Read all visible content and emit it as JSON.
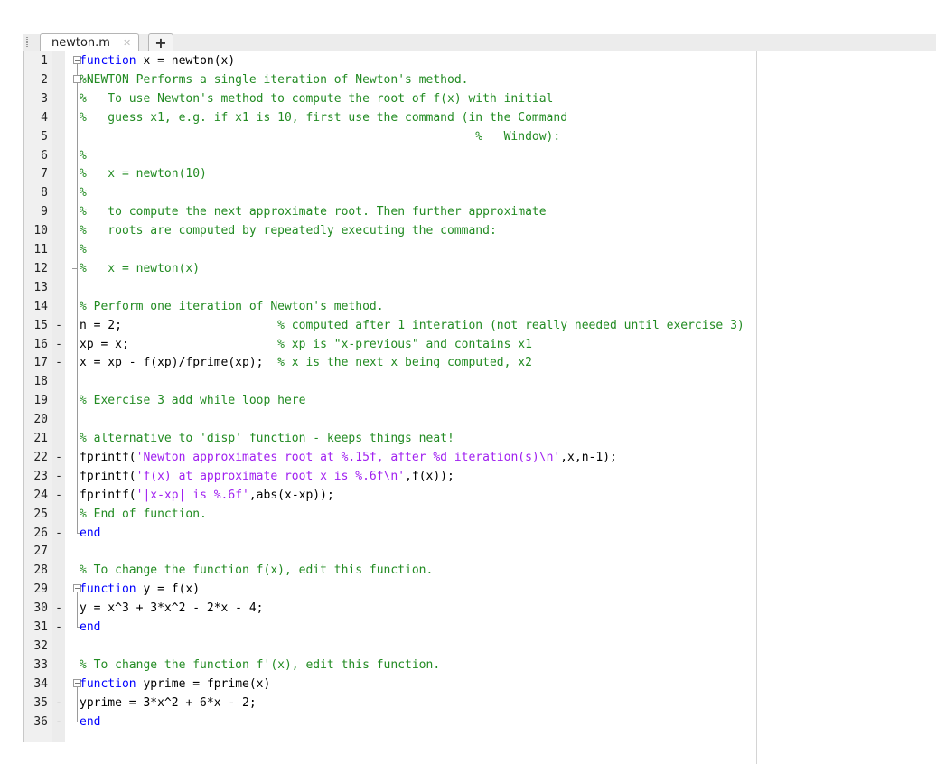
{
  "tabbar": {
    "active_tab": "newton.m",
    "close_glyph": "✕",
    "add_glyph": "+"
  },
  "colors": {
    "keyword": "#0000ff",
    "comment": "#228b22",
    "string": "#a020f0",
    "default": "#000000"
  },
  "lines": [
    {
      "n": "1",
      "mark": "",
      "fold": "start",
      "tokens": [
        [
          "kw",
          "function"
        ],
        [
          "",
          " x = newton(x)"
        ]
      ]
    },
    {
      "n": "2",
      "mark": "",
      "fold": "start2",
      "tokens": [
        [
          "cm",
          "%NEWTON Performs a single iteration of Newton's method."
        ]
      ]
    },
    {
      "n": "3",
      "mark": "",
      "fold": "mid",
      "tokens": [
        [
          "cm",
          "%   To use Newton's method to compute the root of f(x) with initial"
        ]
      ]
    },
    {
      "n": "4",
      "mark": "",
      "fold": "mid",
      "tokens": [
        [
          "cm",
          "%   guess x1, e.g. if x1 is 10, first use the command (in the Command"
        ]
      ]
    },
    {
      "n": "5",
      "mark": "",
      "fold": "mid",
      "tokens": [
        [
          "cm",
          "                                                        %   Window):"
        ]
      ]
    },
    {
      "n": "6",
      "mark": "",
      "fold": "mid",
      "tokens": [
        [
          "cm",
          "%"
        ]
      ]
    },
    {
      "n": "7",
      "mark": "",
      "fold": "mid",
      "tokens": [
        [
          "cm",
          "%   x = newton(10)"
        ]
      ]
    },
    {
      "n": "8",
      "mark": "",
      "fold": "mid",
      "tokens": [
        [
          "cm",
          "%"
        ]
      ]
    },
    {
      "n": "9",
      "mark": "",
      "fold": "mid",
      "tokens": [
        [
          "cm",
          "%   to compute the next approximate root. Then further approximate"
        ]
      ]
    },
    {
      "n": "10",
      "mark": "",
      "fold": "mid",
      "tokens": [
        [
          "cm",
          "%   roots are computed by repeatedly executing the command:"
        ]
      ]
    },
    {
      "n": "11",
      "mark": "",
      "fold": "mid",
      "tokens": [
        [
          "cm",
          "%"
        ]
      ]
    },
    {
      "n": "12",
      "mark": "",
      "fold": "tick",
      "tokens": [
        [
          "cm",
          "%   x = newton(x)"
        ]
      ]
    },
    {
      "n": "13",
      "mark": "",
      "fold": "mid",
      "tokens": []
    },
    {
      "n": "14",
      "mark": "",
      "fold": "mid",
      "tokens": [
        [
          "cm",
          "% Perform one iteration of Newton's method."
        ]
      ]
    },
    {
      "n": "15",
      "mark": "-",
      "fold": "mid",
      "tokens": [
        [
          "",
          "n = 2;                      "
        ],
        [
          "cm",
          "% computed after 1 interation (not really needed until exercise 3)"
        ]
      ]
    },
    {
      "n": "16",
      "mark": "-",
      "fold": "mid",
      "tokens": [
        [
          "",
          "xp = x;                     "
        ],
        [
          "cm",
          "% xp is \"x-previous\" and contains x1"
        ]
      ]
    },
    {
      "n": "17",
      "mark": "-",
      "fold": "mid",
      "tokens": [
        [
          "",
          "x = xp - f(xp)/fprime(xp);  "
        ],
        [
          "cm",
          "% x is the next x being computed, x2"
        ]
      ]
    },
    {
      "n": "18",
      "mark": "",
      "fold": "mid",
      "tokens": []
    },
    {
      "n": "19",
      "mark": "",
      "fold": "mid",
      "tokens": [
        [
          "cm",
          "% Exercise 3 add while loop here"
        ]
      ]
    },
    {
      "n": "20",
      "mark": "",
      "fold": "mid",
      "tokens": []
    },
    {
      "n": "21",
      "mark": "",
      "fold": "mid",
      "tokens": [
        [
          "cm",
          "% alternative to 'disp' function - keeps things neat!"
        ]
      ]
    },
    {
      "n": "22",
      "mark": "-",
      "fold": "mid",
      "tokens": [
        [
          "",
          "fprintf("
        ],
        [
          "st",
          "'Newton approximates root at %.15f, after %d iteration(s)\\n'"
        ],
        [
          "",
          ",x,n-1);"
        ]
      ]
    },
    {
      "n": "23",
      "mark": "-",
      "fold": "mid",
      "tokens": [
        [
          "",
          "fprintf("
        ],
        [
          "st",
          "'f(x) at approximate root x is %.6f\\n'"
        ],
        [
          "",
          ",f(x));"
        ]
      ]
    },
    {
      "n": "24",
      "mark": "-",
      "fold": "mid",
      "tokens": [
        [
          "",
          "fprintf("
        ],
        [
          "st",
          "'|x-xp| is %.6f'"
        ],
        [
          "",
          ",abs(x-xp));"
        ]
      ]
    },
    {
      "n": "25",
      "mark": "",
      "fold": "mid",
      "tokens": [
        [
          "cm",
          "% End of function."
        ]
      ]
    },
    {
      "n": "26",
      "mark": "-",
      "fold": "end",
      "tokens": [
        [
          "kw",
          "end"
        ]
      ]
    },
    {
      "n": "27",
      "mark": "",
      "fold": "",
      "tokens": []
    },
    {
      "n": "28",
      "mark": "",
      "fold": "",
      "tokens": [
        [
          "cm",
          "% To change the function f(x), edit this function."
        ]
      ]
    },
    {
      "n": "29",
      "mark": "",
      "fold": "start",
      "tokens": [
        [
          "kw",
          "function"
        ],
        [
          "",
          " y = f(x)"
        ]
      ]
    },
    {
      "n": "30",
      "mark": "-",
      "fold": "mid",
      "tokens": [
        [
          "",
          "y = x^3 + 3*x^2 - 2*x - 4;"
        ]
      ]
    },
    {
      "n": "31",
      "mark": "-",
      "fold": "end",
      "tokens": [
        [
          "kw",
          "end"
        ]
      ]
    },
    {
      "n": "32",
      "mark": "",
      "fold": "",
      "tokens": []
    },
    {
      "n": "33",
      "mark": "",
      "fold": "",
      "tokens": [
        [
          "cm",
          "% To change the function f'(x), edit this function."
        ]
      ]
    },
    {
      "n": "34",
      "mark": "",
      "fold": "start",
      "tokens": [
        [
          "kw",
          "function"
        ],
        [
          "",
          " yprime = fprime(x)"
        ]
      ]
    },
    {
      "n": "35",
      "mark": "-",
      "fold": "mid",
      "tokens": [
        [
          "",
          "yprime = 3*x^2 + 6*x - 2;"
        ]
      ]
    },
    {
      "n": "36",
      "mark": "-",
      "fold": "end",
      "tokens": [
        [
          "kw",
          "end"
        ]
      ]
    }
  ]
}
